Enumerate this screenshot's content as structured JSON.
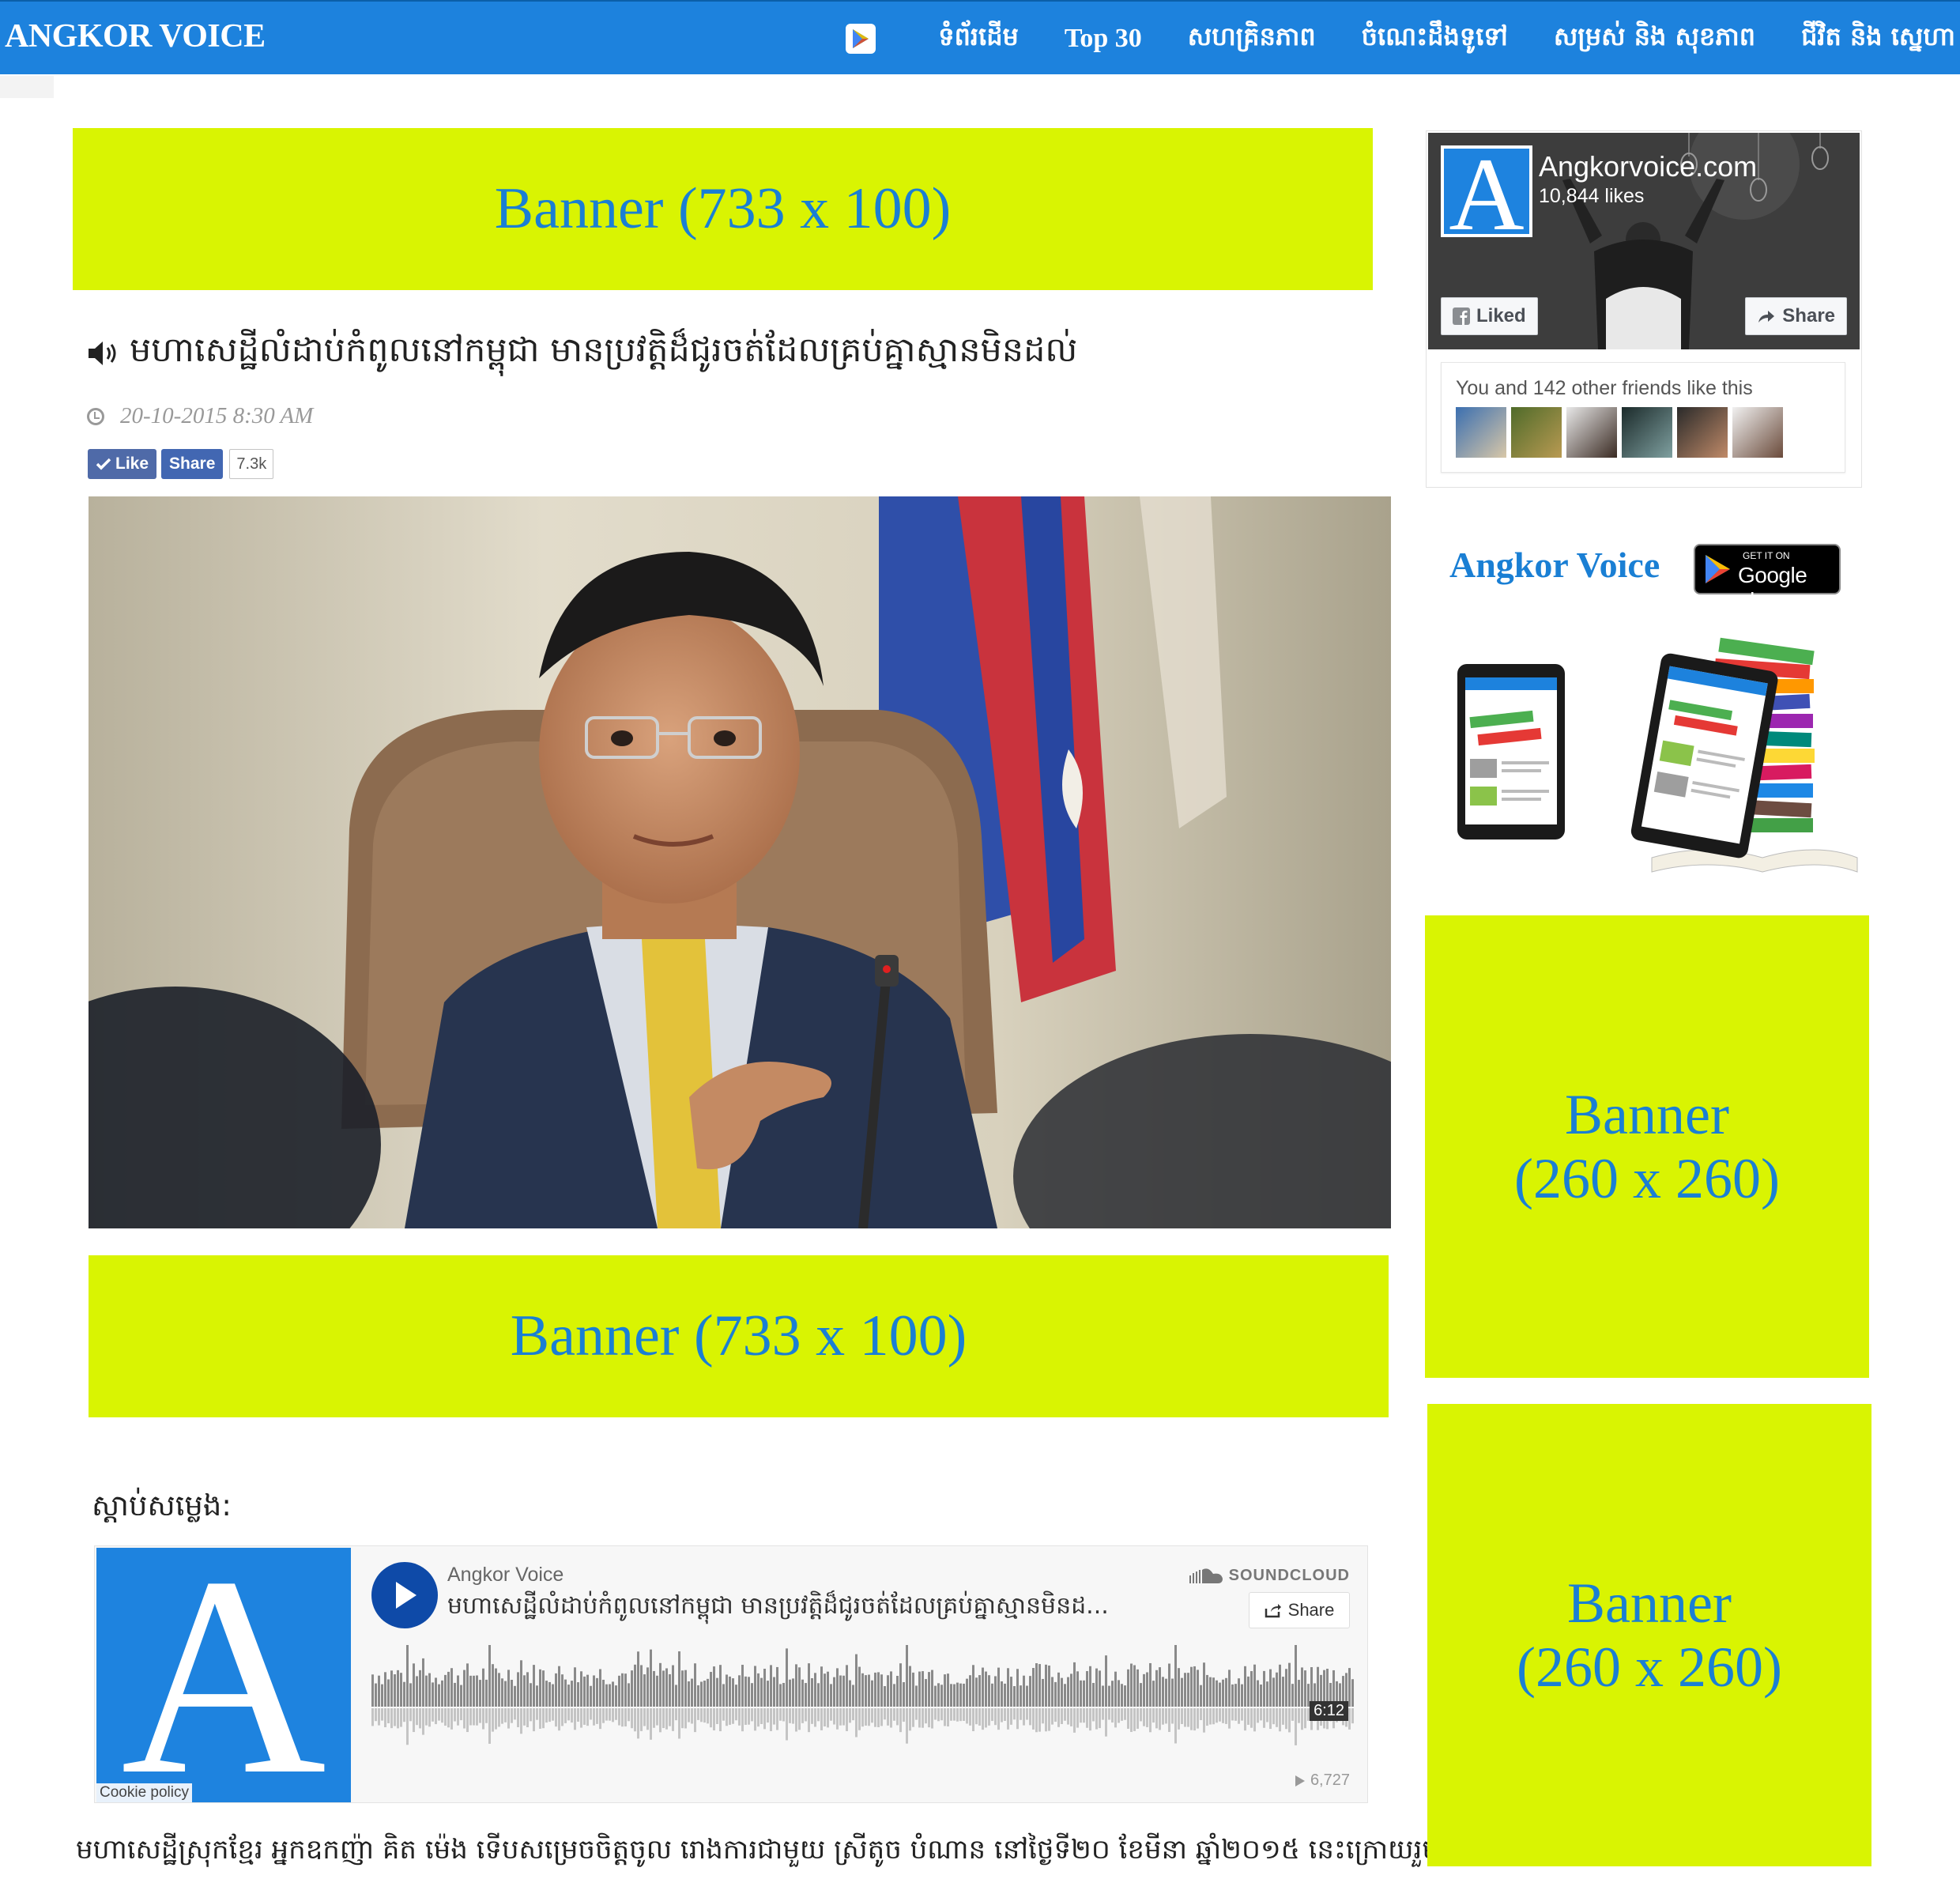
{
  "header": {
    "logo": "ANGKOR VOICE",
    "nav": [
      {
        "label": "ទំព័រដើម"
      },
      {
        "label": "Top 30"
      },
      {
        "label": "សហគ្រិនភាព"
      },
      {
        "label": "ចំណេះដឹងទូទៅ"
      },
      {
        "label": "សម្រស់ និង សុខភាព"
      },
      {
        "label": "ជីវិត និង ស្នេហា"
      }
    ]
  },
  "banners": {
    "top": "Banner (733 x 100)",
    "mid": "Banner (733 x 100)",
    "side1": "Banner\n(260 x 260)",
    "side2": "Banner\n(260 x 260)"
  },
  "article": {
    "title": "មហាសេដ្ឋីលំដាប់កំពូលនៅកម្ពុជា មានប្រវត្តិដ៏ជូរចត់ដែលគ្រប់គ្នាស្មានមិនដល់",
    "date": "20-10-2015 8:30 AM",
    "like_label": "Like",
    "share_label": "Share",
    "share_count": "7.3k",
    "listen_label": "ស្ដាប់សម្លេង:",
    "body_first_line": "មហាសេដ្ឋីស្រុកខ្មែរ អ្នកឧកញ៉ា គិត ម៉េង ទើបសម្រេចចិត្តចូល រោងការជាមួយ ស្រីតូច បំណាន នៅថ្ងៃទី២០ ខែមីនា ឆ្នាំ២០១៥ នេះក្រោយរួមរស់"
  },
  "soundcloud": {
    "user": "Angkor Voice",
    "track": "មហាសេដ្ឋីលំដាប់កំពូលនៅកម្ពុជា មានប្រវត្តិដ៏ជូរចត់ដែលគ្រប់គ្នាស្មានមិនដ...",
    "brand": "SOUNDCLOUD",
    "share": "Share",
    "duration": "6:12",
    "plays": "6,727",
    "cookie": "Cookie policy",
    "art_letter": "A"
  },
  "facebook": {
    "page_name": "Angkorvoice.com",
    "likes": "10,844 likes",
    "liked_label": "Liked",
    "share_label": "Share",
    "friends_text": "You and 142 other friends like this",
    "avatar_letter": "A"
  },
  "app_promo": {
    "title": "Angkor Voice",
    "store_small": "GET IT ON",
    "store_big": "Google play"
  },
  "colors": {
    "nav_bg": "#1d82dd",
    "banner_bg": "#d9f402",
    "banner_text": "#1a7fd4",
    "fb_blue": "#4267b2",
    "sc_play": "#0e4aa8"
  }
}
